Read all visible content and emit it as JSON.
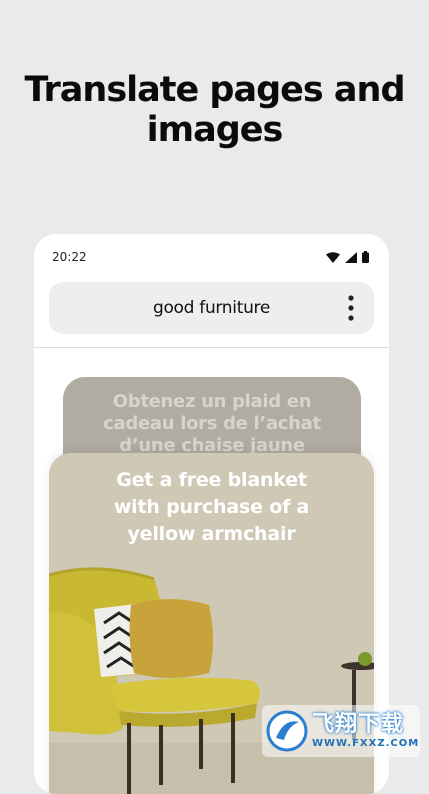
{
  "headline": {
    "line1": "Translate pages and",
    "line2": "images"
  },
  "phone": {
    "status_bar": {
      "time": "20:22",
      "icons": [
        "wifi-icon",
        "signal-icon",
        "battery-icon"
      ]
    },
    "address_bar": {
      "text": "good furniture",
      "menu_icon": "more-vertical-icon"
    },
    "original_card": {
      "line1": "Obtenez un plaid en",
      "line2": "cadeau lors de l’achat",
      "line3": "d’une chaise jaune"
    },
    "translated_card": {
      "line1": "Get a free blanket",
      "line2": "with purchase of a",
      "line3": "yellow armchair"
    }
  },
  "watermark": {
    "big": "飞翔下载",
    "small": "WWW.FXXZ.COM"
  },
  "colors": {
    "background": "#e9eaec",
    "original_card": "#b0aca1",
    "translated_card": "#cfc8b4",
    "chair": "#c9b832",
    "pillow": "#c8a23a"
  }
}
